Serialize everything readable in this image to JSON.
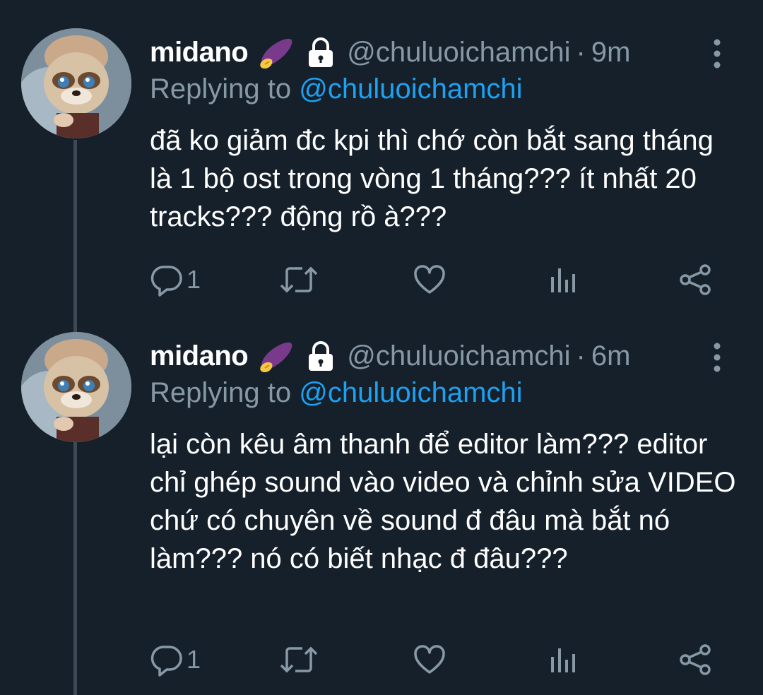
{
  "colors": {
    "background": "#15202b",
    "secondary_text": "#8899a6",
    "mention": "#1da1f2",
    "thread_line": "#3d4a56"
  },
  "tweets": [
    {
      "name": "midano",
      "handle": "@chuluoichamchi",
      "separator": "·",
      "time": "9m",
      "replying_prefix": "Replying to",
      "replying_to": "@chuluoichamchi",
      "text": "đã ko giảm đc kpi thì chớ còn bắt sang tháng là 1 bộ ost trong vòng 1 tháng??? ít nhất 20 tracks??? động rồ à???",
      "reply_count": "1",
      "icons": [
        "sweet-potato-icon",
        "lock-icon",
        "more-vertical-icon",
        "reply-icon",
        "retweet-icon",
        "like-icon",
        "analytics-icon",
        "share-icon"
      ]
    },
    {
      "name": "midano",
      "handle": "@chuluoichamchi",
      "separator": "·",
      "time": "6m",
      "replying_prefix": "Replying to",
      "replying_to": "@chuluoichamchi",
      "text": "lại còn kêu âm thanh để editor làm??? editor chỉ ghép sound vào video và chỉnh sửa VIDEO chứ có chuyên về sound đ đâu mà bắt nó làm??? nó có biết nhạc đ đâu???",
      "reply_count": "1",
      "icons": [
        "sweet-potato-icon",
        "lock-icon",
        "more-vertical-icon",
        "reply-icon",
        "retweet-icon",
        "like-icon",
        "analytics-icon",
        "share-icon"
      ]
    }
  ]
}
